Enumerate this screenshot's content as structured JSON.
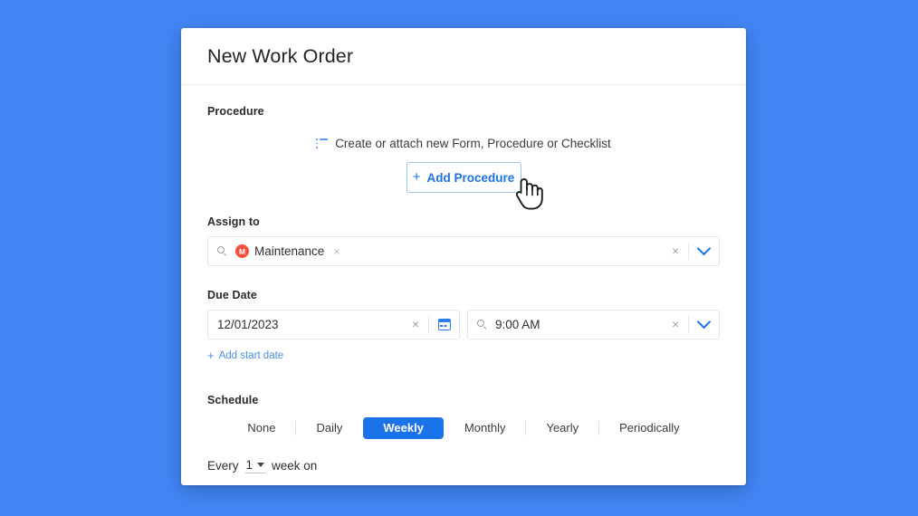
{
  "theme": {
    "background": "#4285f4",
    "accent": "#1a73e8",
    "link": "#4a90e8",
    "avatar": "#f4503c"
  },
  "modal": {
    "title": "New Work Order"
  },
  "procedure": {
    "label": "Procedure",
    "attach_text": "Create or attach new Form, Procedure or Checklist",
    "attach_icon": "list-icon",
    "add_button": {
      "plus": "+",
      "label": "Add Procedure"
    }
  },
  "assign_to": {
    "label": "Assign to",
    "search_icon": "search-icon",
    "chip": {
      "avatar_initial": "M",
      "name": "Maintenance",
      "remove": "×"
    },
    "clear": "×",
    "chevron": "chevron-down-icon"
  },
  "due_date": {
    "label": "Due Date",
    "date": {
      "value": "12/01/2023",
      "clear": "×",
      "calendar_icon": "calendar-icon"
    },
    "time": {
      "search_icon": "search-icon",
      "value": "9:00 AM",
      "clear": "×",
      "chevron": "chevron-down-icon"
    },
    "add_start_date": {
      "plus": "+",
      "label": "Add start date"
    }
  },
  "schedule": {
    "label": "Schedule",
    "tabs": [
      {
        "label": "None",
        "active": false
      },
      {
        "label": "Daily",
        "active": false
      },
      {
        "label": "Weekly",
        "active": true
      },
      {
        "label": "Monthly",
        "active": false
      },
      {
        "label": "Yearly",
        "active": false
      },
      {
        "label": "Periodically",
        "active": false
      }
    ],
    "recurrence": {
      "prefix": "Every",
      "interval": "1",
      "suffix": "week on"
    }
  },
  "cursor": {
    "type": "hand-pointer"
  }
}
